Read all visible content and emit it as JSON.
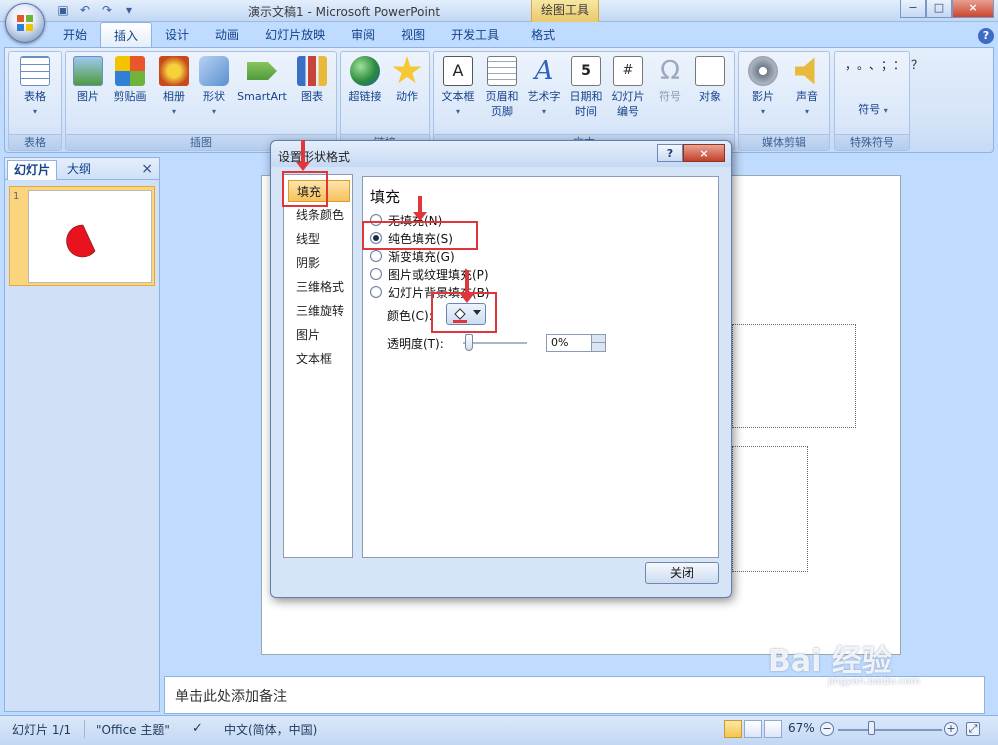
{
  "window": {
    "title": "演示文稿1 - Microsoft PowerPoint",
    "context_tab_title": "绘图工具",
    "minimize": "−",
    "maximize": "□",
    "close": "×"
  },
  "ribbon_tabs": [
    {
      "label": "开始"
    },
    {
      "label": "插入",
      "active": true
    },
    {
      "label": "设计"
    },
    {
      "label": "动画"
    },
    {
      "label": "幻灯片放映"
    },
    {
      "label": "审阅"
    },
    {
      "label": "视图"
    },
    {
      "label": "开发工具"
    },
    {
      "label": "格式"
    }
  ],
  "help": "?",
  "ribbon": {
    "groups": {
      "table": "表格",
      "illustrations": "插图",
      "links": "链接",
      "text": "文本",
      "media": "媒体剪辑",
      "symbols": "特殊符号"
    },
    "buttons": {
      "table": "表格",
      "picture": "图片",
      "clipart": "剪贴画",
      "album": "相册",
      "shapes": "形状",
      "smartart": "SmartArt",
      "chart": "图表",
      "hyperlink": "超链接",
      "action": "动作",
      "textbox": "文本框",
      "header_footer": "页眉和页脚",
      "wordart": "艺术字",
      "datetime": "日期和时间",
      "slide_number": "幻灯片编号",
      "symbol": "符号",
      "object": "对象",
      "movie": "影片",
      "sound": "声音",
      "special_symbol": "符号"
    },
    "symbol_chars": "，。、；：？",
    "dropdown": "▾"
  },
  "left_pane": {
    "tab_slides": "幻灯片",
    "tab_outline": "大纲",
    "close": "×",
    "slide_number": "1"
  },
  "notes_placeholder": "单击此处添加备注",
  "status": {
    "slide_info": "幻灯片 1/1",
    "theme": "\"Office 主题\"",
    "language": "中文(简体，中国)",
    "zoom": "67%",
    "zoom_minus": "−",
    "zoom_plus": "+"
  },
  "dialog": {
    "title": "设置形状格式",
    "help": "?",
    "close_x": "×",
    "nav": [
      {
        "label": "填充",
        "selected": true
      },
      {
        "label": "线条颜色"
      },
      {
        "label": "线型"
      },
      {
        "label": "阴影"
      },
      {
        "label": "三维格式"
      },
      {
        "label": "三维旋转"
      },
      {
        "label": "图片"
      },
      {
        "label": "文本框"
      }
    ],
    "panel_title": "填充",
    "fill_options": [
      {
        "label": "无填充(N)",
        "checked": false
      },
      {
        "label": "纯色填充(S)",
        "checked": true
      },
      {
        "label": "渐变填充(G)",
        "checked": false
      },
      {
        "label": "图片或纹理填充(P)",
        "checked": false
      },
      {
        "label": "幻灯片背景填充(B)",
        "checked": false
      }
    ],
    "color_label": "颜色(C):",
    "transparency_label": "透明度(T):",
    "transparency_value": "0%",
    "close_button": "关闭",
    "accent_color": "#e0353a"
  },
  "watermark": {
    "text": "Bai 经验",
    "sub": "jingyan.baidu.com"
  }
}
